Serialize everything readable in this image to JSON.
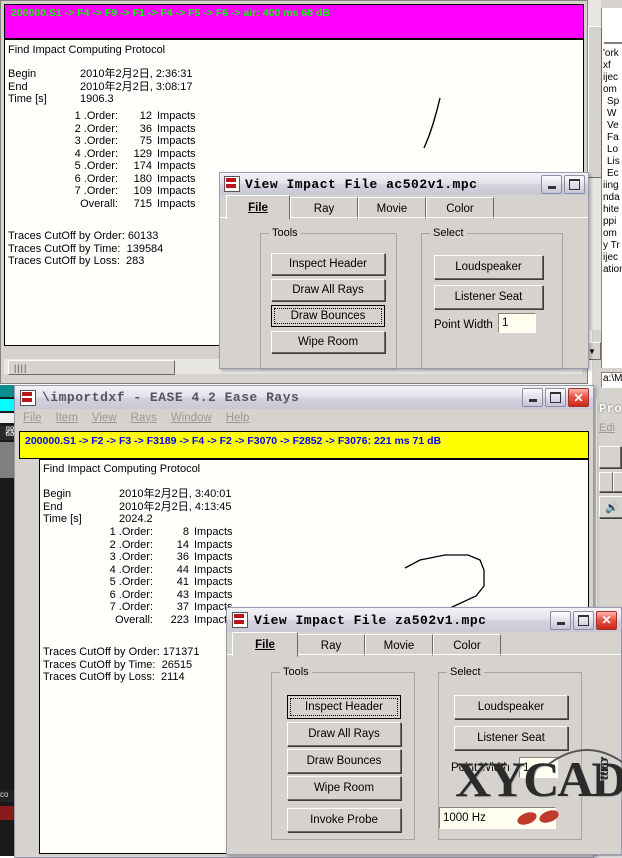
{
  "desktop": {
    "bg": "#ffffff"
  },
  "window_back": {
    "title_fragment": "Pro",
    "menu_fragment": "Edi",
    "tree_fragments": [
      "'ork",
      "xf",
      "ijec",
      "om",
      "Sp",
      "W",
      "Ve",
      "Fa",
      "Lo",
      "Lis",
      "Ec",
      "iing",
      "nda",
      "hite",
      "ppi",
      "om",
      "y Tr",
      "ijec",
      "ation",
      "a:\\M"
    ]
  },
  "win1": {
    "color_bar": {
      "text": "200000.S1 -> F4 -> F9 -> F1 -> F4 -> F5 -> F6 -> air: 400 ms 68 dB",
      "bg": "#ff00ff",
      "fg": "#00ff00"
    },
    "log": {
      "heading": "Find Impact Computing Protocol",
      "rows": [
        {
          "label": "Begin",
          "value": "2010年2月2日, 2:36:31"
        },
        {
          "label": "End",
          "value": "2010年2月2日, 3:08:17"
        },
        {
          "label": "Time [s]",
          "value": "1906.3"
        }
      ],
      "orders": [
        {
          "order": "1 .Order:",
          "count": "12",
          "unit": "Impacts"
        },
        {
          "order": "2 .Order:",
          "count": "36",
          "unit": "Impacts"
        },
        {
          "order": "3 .Order:",
          "count": "75",
          "unit": "Impacts"
        },
        {
          "order": "4 .Order:",
          "count": "129",
          "unit": "Impacts"
        },
        {
          "order": "5 .Order:",
          "count": "174",
          "unit": "Impacts"
        },
        {
          "order": "6 .Order:",
          "count": "180",
          "unit": "Impacts"
        },
        {
          "order": "7 .Order:",
          "count": "109",
          "unit": "Impacts"
        },
        {
          "order": "Overall:",
          "count": "715",
          "unit": "Impacts"
        }
      ],
      "cutoffs": [
        "Traces CutOff by Order: 60133",
        "Traces CutOff by Time:  139584",
        "Traces CutOff by Loss:  283"
      ]
    }
  },
  "dlg1": {
    "title": "View Impact File ac502v1.mpc",
    "icon": "ease-app-icon",
    "buttons": {
      "minimize": "minimize-button",
      "maximize": "maximize-button"
    },
    "tabs": [
      {
        "label": "File",
        "accel": "F",
        "active": true
      },
      {
        "label": "Ray",
        "accel": "R",
        "active": false
      },
      {
        "label": "Movie",
        "accel": "M",
        "active": false
      },
      {
        "label": "Color",
        "accel": "C",
        "active": false
      }
    ],
    "tools": {
      "title": "Tools",
      "items": [
        {
          "label": "Inspect Header",
          "accel": "H",
          "focused": false
        },
        {
          "label": "Draw All Rays",
          "accel": "D",
          "focused": false
        },
        {
          "label": "Draw Bounces",
          "accel": "B",
          "focused": true
        },
        {
          "label": "Wipe Room",
          "accel": "R",
          "focused": false
        }
      ]
    },
    "select": {
      "title": "Select",
      "items": [
        {
          "label": "Loudspeaker",
          "accel": "L"
        },
        {
          "label": "Listener Seat",
          "accel": "S"
        }
      ],
      "point_width_label": "Point Width",
      "point_width_value": "1"
    }
  },
  "win2": {
    "title": "\\importdxf - EASE 4.2 Ease Rays",
    "menu": [
      {
        "label": "File",
        "accel": "F"
      },
      {
        "label": "Item",
        "accel": "I"
      },
      {
        "label": "View",
        "accel": "V"
      },
      {
        "label": "Rays",
        "accel": "R"
      },
      {
        "label": "Window",
        "accel": "W"
      },
      {
        "label": "Help",
        "accel": "H"
      }
    ],
    "buttons": {
      "minimize": "minimize-button",
      "maximize": "maximize-button",
      "close": "close-button"
    },
    "color_bar": {
      "text": "200000.S1 -> F2 -> F3 -> F3189 -> F4 -> F2 -> F3070 -> F2852 -> F3076: 221 ms 71 dB",
      "bg": "#ffff00",
      "fg": "#0000ff"
    },
    "log": {
      "heading": "Find Impact Computing Protocol",
      "rows": [
        {
          "label": "Begin",
          "value": "2010年2月2日, 3:40:01"
        },
        {
          "label": "End",
          "value": "2010年2月2日, 4:13:45"
        },
        {
          "label": "Time [s]",
          "value": "2024.2"
        }
      ],
      "orders": [
        {
          "order": "1 .Order:",
          "count": "8",
          "unit": "Impacts"
        },
        {
          "order": "2 .Order:",
          "count": "14",
          "unit": "Impacts"
        },
        {
          "order": "3 .Order:",
          "count": "36",
          "unit": "Impacts"
        },
        {
          "order": "4 .Order:",
          "count": "44",
          "unit": "Impacts"
        },
        {
          "order": "5 .Order:",
          "count": "41",
          "unit": "Impacts"
        },
        {
          "order": "6 .Order:",
          "count": "43",
          "unit": "Impacts"
        },
        {
          "order": "7 .Order:",
          "count": "37",
          "unit": "Impacts"
        },
        {
          "order": "Overall:",
          "count": "223",
          "unit": "Impacts"
        }
      ],
      "cutoffs": [
        "Traces CutOff by Order: 171371",
        "Traces CutOff by Time:  26515",
        "Traces CutOff by Loss:  2114"
      ]
    }
  },
  "dlg2": {
    "title": "View Impact File za502v1.mpc",
    "icon": "ease-app-icon",
    "buttons": {
      "minimize": "minimize-button",
      "maximize": "maximize-button",
      "close": "close-button"
    },
    "tabs": [
      {
        "label": "File",
        "accel": "F",
        "active": true
      },
      {
        "label": "Ray",
        "accel": "R",
        "active": false
      },
      {
        "label": "Movie",
        "accel": "M",
        "active": false
      },
      {
        "label": "Color",
        "accel": "C",
        "active": false
      }
    ],
    "tools": {
      "title": "Tools",
      "items": [
        {
          "label": "Inspect Header",
          "accel": "H",
          "focused": true
        },
        {
          "label": "Draw All Rays",
          "accel": "D",
          "focused": false
        },
        {
          "label": "Draw Bounces",
          "accel": "B",
          "focused": false
        },
        {
          "label": "Wipe Room",
          "accel": "R",
          "focused": false
        },
        {
          "label": "Invoke Probe",
          "accel": "P",
          "focused": false
        }
      ]
    },
    "select": {
      "title": "Select",
      "items": [
        {
          "label": "Loudspeaker",
          "accel": "L"
        },
        {
          "label": "Listener Seat",
          "accel": "S"
        }
      ],
      "point_width_label": "Point Width",
      "point_width_value": "1",
      "frequency_value": "1000 Hz"
    }
  },
  "watermark": {
    "main": "XYCAD",
    "suffix": ".com"
  }
}
